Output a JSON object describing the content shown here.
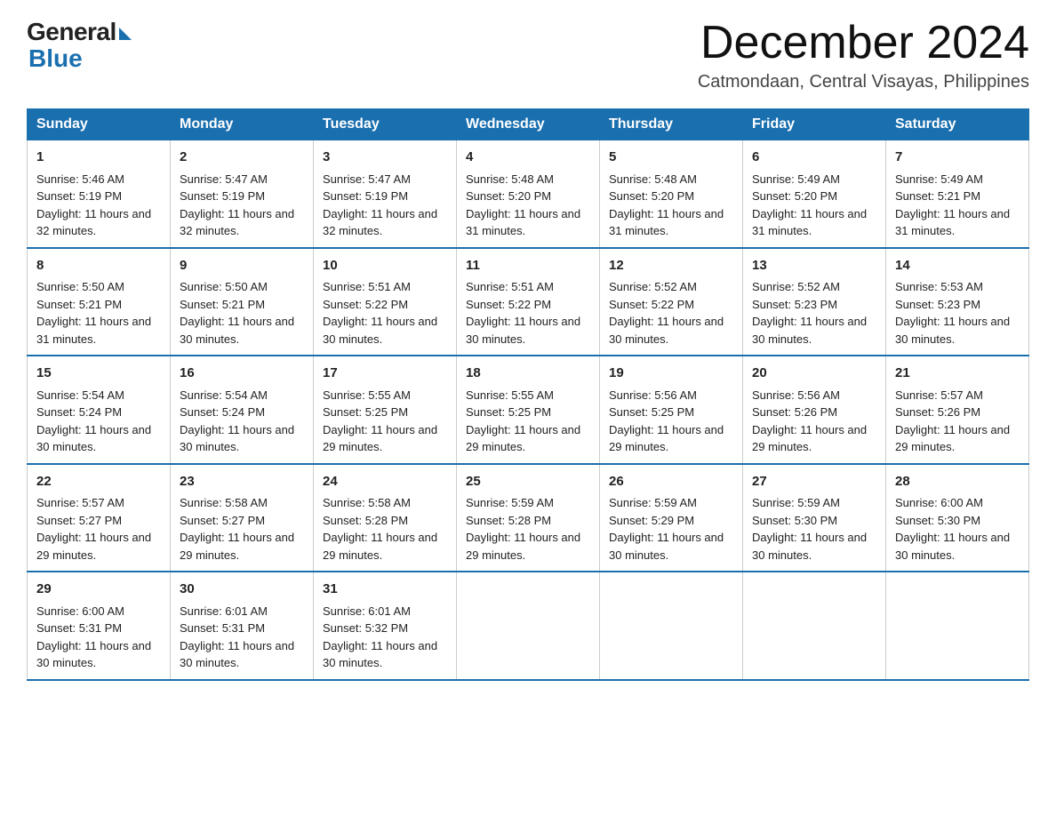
{
  "logo": {
    "general": "General",
    "blue": "Blue"
  },
  "title": "December 2024",
  "location": "Catmondaan, Central Visayas, Philippines",
  "days_of_week": [
    "Sunday",
    "Monday",
    "Tuesday",
    "Wednesday",
    "Thursday",
    "Friday",
    "Saturday"
  ],
  "weeks": [
    [
      {
        "day": "1",
        "sunrise": "5:46 AM",
        "sunset": "5:19 PM",
        "daylight": "11 hours and 32 minutes."
      },
      {
        "day": "2",
        "sunrise": "5:47 AM",
        "sunset": "5:19 PM",
        "daylight": "11 hours and 32 minutes."
      },
      {
        "day": "3",
        "sunrise": "5:47 AM",
        "sunset": "5:19 PM",
        "daylight": "11 hours and 32 minutes."
      },
      {
        "day": "4",
        "sunrise": "5:48 AM",
        "sunset": "5:20 PM",
        "daylight": "11 hours and 31 minutes."
      },
      {
        "day": "5",
        "sunrise": "5:48 AM",
        "sunset": "5:20 PM",
        "daylight": "11 hours and 31 minutes."
      },
      {
        "day": "6",
        "sunrise": "5:49 AM",
        "sunset": "5:20 PM",
        "daylight": "11 hours and 31 minutes."
      },
      {
        "day": "7",
        "sunrise": "5:49 AM",
        "sunset": "5:21 PM",
        "daylight": "11 hours and 31 minutes."
      }
    ],
    [
      {
        "day": "8",
        "sunrise": "5:50 AM",
        "sunset": "5:21 PM",
        "daylight": "11 hours and 31 minutes."
      },
      {
        "day": "9",
        "sunrise": "5:50 AM",
        "sunset": "5:21 PM",
        "daylight": "11 hours and 30 minutes."
      },
      {
        "day": "10",
        "sunrise": "5:51 AM",
        "sunset": "5:22 PM",
        "daylight": "11 hours and 30 minutes."
      },
      {
        "day": "11",
        "sunrise": "5:51 AM",
        "sunset": "5:22 PM",
        "daylight": "11 hours and 30 minutes."
      },
      {
        "day": "12",
        "sunrise": "5:52 AM",
        "sunset": "5:22 PM",
        "daylight": "11 hours and 30 minutes."
      },
      {
        "day": "13",
        "sunrise": "5:52 AM",
        "sunset": "5:23 PM",
        "daylight": "11 hours and 30 minutes."
      },
      {
        "day": "14",
        "sunrise": "5:53 AM",
        "sunset": "5:23 PM",
        "daylight": "11 hours and 30 minutes."
      }
    ],
    [
      {
        "day": "15",
        "sunrise": "5:54 AM",
        "sunset": "5:24 PM",
        "daylight": "11 hours and 30 minutes."
      },
      {
        "day": "16",
        "sunrise": "5:54 AM",
        "sunset": "5:24 PM",
        "daylight": "11 hours and 30 minutes."
      },
      {
        "day": "17",
        "sunrise": "5:55 AM",
        "sunset": "5:25 PM",
        "daylight": "11 hours and 29 minutes."
      },
      {
        "day": "18",
        "sunrise": "5:55 AM",
        "sunset": "5:25 PM",
        "daylight": "11 hours and 29 minutes."
      },
      {
        "day": "19",
        "sunrise": "5:56 AM",
        "sunset": "5:25 PM",
        "daylight": "11 hours and 29 minutes."
      },
      {
        "day": "20",
        "sunrise": "5:56 AM",
        "sunset": "5:26 PM",
        "daylight": "11 hours and 29 minutes."
      },
      {
        "day": "21",
        "sunrise": "5:57 AM",
        "sunset": "5:26 PM",
        "daylight": "11 hours and 29 minutes."
      }
    ],
    [
      {
        "day": "22",
        "sunrise": "5:57 AM",
        "sunset": "5:27 PM",
        "daylight": "11 hours and 29 minutes."
      },
      {
        "day": "23",
        "sunrise": "5:58 AM",
        "sunset": "5:27 PM",
        "daylight": "11 hours and 29 minutes."
      },
      {
        "day": "24",
        "sunrise": "5:58 AM",
        "sunset": "5:28 PM",
        "daylight": "11 hours and 29 minutes."
      },
      {
        "day": "25",
        "sunrise": "5:59 AM",
        "sunset": "5:28 PM",
        "daylight": "11 hours and 29 minutes."
      },
      {
        "day": "26",
        "sunrise": "5:59 AM",
        "sunset": "5:29 PM",
        "daylight": "11 hours and 30 minutes."
      },
      {
        "day": "27",
        "sunrise": "5:59 AM",
        "sunset": "5:30 PM",
        "daylight": "11 hours and 30 minutes."
      },
      {
        "day": "28",
        "sunrise": "6:00 AM",
        "sunset": "5:30 PM",
        "daylight": "11 hours and 30 minutes."
      }
    ],
    [
      {
        "day": "29",
        "sunrise": "6:00 AM",
        "sunset": "5:31 PM",
        "daylight": "11 hours and 30 minutes."
      },
      {
        "day": "30",
        "sunrise": "6:01 AM",
        "sunset": "5:31 PM",
        "daylight": "11 hours and 30 minutes."
      },
      {
        "day": "31",
        "sunrise": "6:01 AM",
        "sunset": "5:32 PM",
        "daylight": "11 hours and 30 minutes."
      },
      null,
      null,
      null,
      null
    ]
  ],
  "labels": {
    "sunrise": "Sunrise:",
    "sunset": "Sunset:",
    "daylight": "Daylight:"
  }
}
